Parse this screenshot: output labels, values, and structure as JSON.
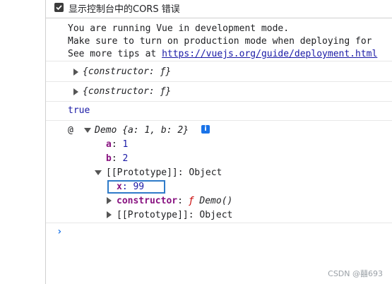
{
  "settings": {
    "cors_checkbox_label": "显示控制台中的CORS 错误",
    "cors_checked": true
  },
  "vue_message": {
    "line1": "You are running Vue in development mode.",
    "line2": "Make sure to turn on production mode when deploying for",
    "line3_prefix": "See more tips at ",
    "line3_link": "https://vuejs.org/guide/deployment.html"
  },
  "log_entries": [
    {
      "text": "{constructor: ƒ}"
    },
    {
      "text": "{constructor: ƒ}"
    }
  ],
  "boolean_output": "true",
  "demo_object": {
    "at_sign": "@",
    "summary": "Demo {a: 1, b: 2}",
    "info_badge": "i",
    "props": [
      {
        "key": "a",
        "colon": ": ",
        "value": "1"
      },
      {
        "key": "b",
        "colon": ": ",
        "value": "2"
      }
    ],
    "prototype_label": "[[Prototype]]",
    "prototype_value": ": Object",
    "proto_props": {
      "x_key": "x",
      "x_value": ": 99",
      "constructor_key": "constructor",
      "constructor_sep": ": ",
      "constructor_fn": "ƒ",
      "constructor_value": " Demo()",
      "inner_prototype_label": "[[Prototype]]",
      "inner_prototype_value": ": Object"
    }
  },
  "prompt_symbol": "›",
  "watermark": "CSDN @囍693",
  "icons": {
    "checkbox": "checkmark-icon",
    "expand_collapsed": "caret-right-icon",
    "expand_open": "caret-down-icon",
    "info": "info-icon",
    "prompt": "chevron-right-icon"
  },
  "colors": {
    "link": "#1a1aa6",
    "property_key": "#881280",
    "value": "#1a1aa6",
    "highlight_box": "#2f7bc9",
    "prompt": "#1a73e8"
  }
}
